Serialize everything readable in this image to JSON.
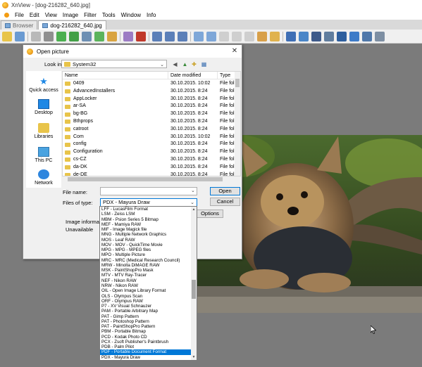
{
  "app": {
    "title": "XnView - [dog-216282_640.jpg]",
    "menus": [
      "File",
      "Edit",
      "View",
      "Image",
      "Filter",
      "Tools",
      "Window",
      "Info"
    ],
    "tabs": [
      {
        "label": "Browser",
        "active": false
      },
      {
        "label": "dog-216282_640.jpg",
        "active": true
      }
    ]
  },
  "dialog": {
    "title": "Open picture",
    "look_in_label": "Look in:",
    "look_in_value": "System32",
    "places": [
      "Quick access",
      "Desktop",
      "Libraries",
      "This PC",
      "Network"
    ],
    "columns": [
      "Name",
      "Date modified",
      "Type"
    ],
    "files": [
      {
        "name": "0409",
        "date": "30.10.2015. 10:02",
        "type": "File fol"
      },
      {
        "name": "AdvancedInstallers",
        "date": "30.10.2015. 8:24",
        "type": "File fol"
      },
      {
        "name": "AppLocker",
        "date": "30.10.2015. 8:24",
        "type": "File fol"
      },
      {
        "name": "ar-SA",
        "date": "30.10.2015. 8:24",
        "type": "File fol"
      },
      {
        "name": "bg-BG",
        "date": "30.10.2015. 8:24",
        "type": "File fol"
      },
      {
        "name": "Bthprops",
        "date": "30.10.2015. 8:24",
        "type": "File fol"
      },
      {
        "name": "catroot",
        "date": "30.10.2015. 8:24",
        "type": "File fol"
      },
      {
        "name": "Com",
        "date": "30.10.2015. 10:02",
        "type": "File fol"
      },
      {
        "name": "config",
        "date": "30.10.2015. 8:24",
        "type": "File fol"
      },
      {
        "name": "Configuration",
        "date": "30.10.2015. 8:24",
        "type": "File fol"
      },
      {
        "name": "cs-CZ",
        "date": "30.10.2015. 8:24",
        "type": "File fol"
      },
      {
        "name": "da-DK",
        "date": "30.10.2015. 8:24",
        "type": "File fol"
      },
      {
        "name": "de-DE",
        "date": "30.10.2015. 8:24",
        "type": "File fol"
      }
    ],
    "file_name_label": "File name:",
    "file_name_value": "",
    "files_of_type_label": "Files of type:",
    "files_of_type_value": "PDX - Mayura Draw",
    "open_label": "Open",
    "cancel_label": "Cancel",
    "options_label": "Options",
    "info_label": "Image information",
    "info_value": "Unavailable",
    "dropdown_items": [
      "LFF - LucasFilm Format",
      "LSM - Zeiss LSM",
      "MBM - Psion Series 5 Bitmap",
      "MEF - Mamiya RAW",
      "MIF - Image Magick file",
      "MNG - Multiple Network Graphics",
      "MOS - Leaf RAW",
      "MOV - MOV - QuickTime Movie",
      "MPG - MPG - MPEG files",
      "MPO - Multiple Picture",
      "MRC - MRC (Medical Research Council)",
      "MRW - Minolta DiMAGE RAW",
      "MSK - PaintShopPro Mask",
      "MTV - MTV Ray-Tracer",
      "NEF - Nikon RAW",
      "NRW - Nikon RAW",
      "OIL - Open Image Library Format",
      "OLS - Olympus Scan",
      "ORF - Olympus RAW",
      "P7 - XV Visual Schnauzer",
      "PAM - Portable Arbitrary Map",
      "PAT - Gimp Pattern",
      "PAT - Photoshop Pattern",
      "PAT - PaintShopPro Pattern",
      "PBM - Portable Bitmap",
      "PCD - Kodak Photo CD",
      "PCX - Zsoft Publisher's Paintbrush",
      "PDB - Palm Pilot",
      "PDF - Portable Document Format",
      "PDX - Mayura Draw"
    ],
    "dropdown_selected_index": 28
  },
  "colors": {
    "accent": "#0078d7",
    "selected_text": "#ffffff"
  }
}
